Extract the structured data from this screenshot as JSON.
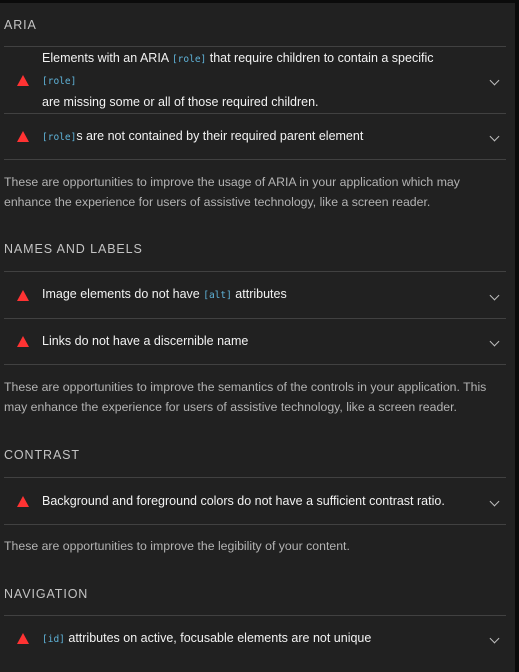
{
  "sections": [
    {
      "title": "ARIA",
      "audits": [
        {
          "line1_a": "Elements with an ARIA ",
          "line1_code": "[role]",
          "line1_b": " that require children to contain a specific ",
          "line1_code2": "[role]",
          "line2": "are missing some or all of those required children."
        },
        {
          "code": "[role]",
          "text": "s are not contained by their required parent element"
        }
      ],
      "description": "These are opportunities to improve the usage of ARIA in your application which may enhance the experience for users of assistive technology, like a screen reader."
    },
    {
      "title": "NAMES AND LABELS",
      "audits": [
        {
          "text_a": "Image elements do not have ",
          "code": "[alt]",
          "text_b": " attributes"
        },
        {
          "text": "Links do not have a discernible name"
        }
      ],
      "description": "These are opportunities to improve the semantics of the controls in your application. This may enhance the experience for users of assistive technology, like a screen reader."
    },
    {
      "title": "CONTRAST",
      "audits": [
        {
          "text": "Background and foreground colors do not have a sufficient contrast ratio."
        }
      ],
      "description": "These are opportunities to improve the legibility of your content."
    },
    {
      "title": "NAVIGATION",
      "audits": [
        {
          "code": "[id]",
          "text": " attributes on active, focusable elements are not unique"
        }
      ]
    }
  ],
  "colors": {
    "background": "#212121",
    "fail_icon": "#ff3333",
    "code": "#5fb3d9",
    "divider": "#414141"
  },
  "icons": {
    "fail": "warning-triangle-icon",
    "expand": "chevron-down-icon"
  }
}
